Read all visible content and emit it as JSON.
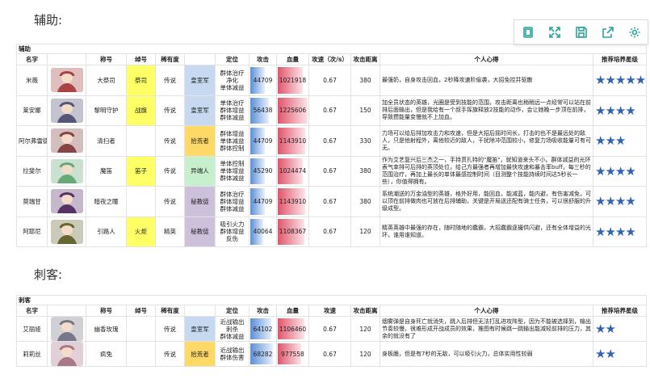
{
  "toolbar": {
    "icons": [
      "window-icon",
      "fullscreen-icon",
      "save-icon",
      "share-icon",
      "gear-icon"
    ]
  },
  "sections": [
    {
      "title": "辅助:",
      "group_label": "辅助",
      "headers": [
        "名字",
        "",
        "称号",
        "绰号",
        "稀有度",
        "",
        "定位",
        "攻击",
        "血量",
        "攻速（次/s）",
        "攻击距离",
        "个人心得",
        "推荐培养星级"
      ],
      "rows": [
        {
          "name": "米薇",
          "title": "大祭司",
          "nickname": "祭司",
          "rarity": "传说",
          "faction": "皇室军",
          "role": "群体治疗\n净化\n单体减益",
          "atk": "44709",
          "hp": "1021918",
          "speed": "0.67",
          "range": "380",
          "note": "最强奶，自身攻击回血，2秒降攻速阶偷袭，大招免控并驱散",
          "stars": "★★★★★",
          "atk_frac": 0.55,
          "hp_frac": 0.8
        },
        {
          "name": "莱安娜",
          "title": "黎明守护",
          "nickname": "战旗",
          "rarity": "传说",
          "faction": "皇室军",
          "role": "单体治疗\n群体增益\n群体减益",
          "atk": "56438",
          "hp": "1225606",
          "speed": "0.67",
          "range": "150",
          "note": "加全员状态的英雄，光圈是受到技能的范围，攻击距离也稍稍远一点经常可以站在前排后面输出，但是我给有一个叔手挥旗释放2技能的动作，会让她晚一步顶在前排，导致攒能量变慢就不上加血。",
          "stars": "★★★★",
          "atk_frac": 0.7,
          "hp_frac": 0.95
        },
        {
          "name": "阿尔弗雷德",
          "title": "清扫者",
          "nickname": "",
          "rarity": "传说",
          "faction": "拾荒者",
          "role": "群体增益\n单体减益\n群体控制",
          "atk": "44709",
          "hp": "1143910",
          "speed": "0.67",
          "range": "330",
          "note": "力场可以给后排加攻击力和攻速，但是大招后摇时间长，打击的也不是最远处的敌人，只是他射程外，离他较近的敌人，干扰除冲范围较小，修复力场吸收能量可有可无。",
          "stars": "★★★",
          "atk_frac": 0.55,
          "hp_frac": 0.88
        },
        {
          "name": "拉斐尔",
          "title": "魔笛",
          "nickname": "笛子",
          "rarity": "传说",
          "faction": "异端人",
          "role": "单体控制\n单体增益\n群体减益",
          "atk": "45290",
          "hp": "1024474",
          "speed": "0.67",
          "range": "380",
          "note": "作为艾艺复兴后三杰之一，手持贯扎特的\"魔笛\"，就知道来头不小。群体减益的光环表气幸排可后排的英顶处位，给己方最强者再增加最快攻速和暴击率buff，每三秒的范围治疗，再加上最长的单体最感控制时间（目测整个技能持续时间达5秒长一些），你值得拥有。",
          "stars": "★★★★",
          "atk_frac": 0.56,
          "hp_frac": 0.8
        },
        {
          "name": "莫瑞甘",
          "title": "暗夜之瞳",
          "nickname": "",
          "rarity": "传说",
          "faction": "秘教徒",
          "role": "群体治疗\n群体增益\n群体减益",
          "atk": "44709",
          "hp": "1143910",
          "speed": "0.67",
          "range": "380",
          "note": "系统潮送的万金油型的英雄，格外好用，能回血，能减蓝，能内避，有伤害减免，可以顶在前排做肉也可放在后排辅助，关键是开局送还配有骑士任务，可以很舒服的升级成型。",
          "stars": "★★★★",
          "atk_frac": 0.55,
          "hp_frac": 0.88
        },
        {
          "name": "阿耶尼",
          "title": "引路人",
          "nickname": "火炬",
          "rarity": "精英",
          "faction": "秘教徒",
          "role": "吸引火力\n群体增益\n反伤",
          "atk": "40064",
          "hp": "1108367",
          "speed": "0.67",
          "range": "120",
          "note": "精英英雄中最强的存在，随时随地的蠢霸，大招蠢霸逐撮供闪避，还有全体增益的光环，谁用谁知道。",
          "stars": "★★★★",
          "atk_frac": 0.48,
          "hp_frac": 0.85
        }
      ]
    },
    {
      "title": "刺客:",
      "group_label": "刺客",
      "headers": [
        "名字",
        "",
        "称号",
        "绰号",
        "稀有度",
        "",
        "定位",
        "攻击",
        "血量",
        "攻速",
        "攻击距离",
        "个人心得",
        "推荐培养星级"
      ],
      "rows": [
        {
          "name": "艾丽娅",
          "title": "幽香玫瑰",
          "nickname": "",
          "rarity": "传说",
          "faction": "皇室军",
          "role": "近战输出\n刺杀\n群体减益",
          "atk": "64102",
          "hp": "1106460",
          "speed": "0.67",
          "range": "120",
          "note": "烟雾弹是自身死亡就消失，跳入后排但无法打乱进攻阵型，因为不能被选择到，输出节奏较慢，很难形成开战成员的效果，推图有时候跳一跳输出能减轻前排的压力，其余的就没有了",
          "stars": "★★",
          "atk_frac": 0.8,
          "hp_frac": 0.85
        },
        {
          "name": "莉莉丝",
          "title": "疯兔",
          "nickname": "",
          "rarity": "传说",
          "faction": "拾荒者",
          "role": "近战输出\n群体伤害",
          "atk": "68282",
          "hp": "977558",
          "speed": "0.67",
          "range": "120",
          "note": "身板脆，但是有7秒的无敌，可以吸引火力，总体实用性较弱",
          "stars": "★★",
          "atk_frac": 0.85,
          "hp_frac": 0.75
        }
      ]
    }
  ],
  "colors": {
    "nickname": "#ffff66",
    "faction_royal": "#c6d9f0",
    "faction_scav": "#ffd966",
    "faction_heretic": "#c6efce",
    "faction_cult": "#ccc0da",
    "stars": "#2f64b5",
    "toolbar_icon": "#2aa59a"
  }
}
